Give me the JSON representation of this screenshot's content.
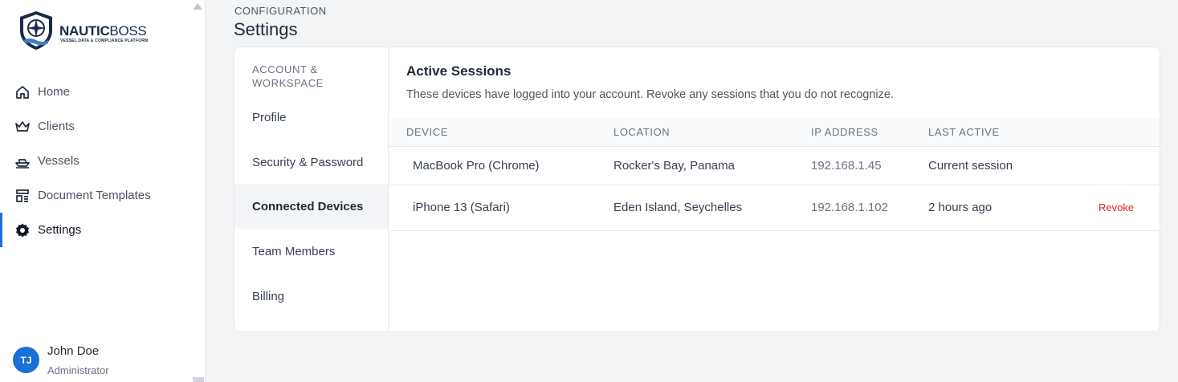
{
  "brand": {
    "name_bold": "NAUTIC",
    "name_rest": "BOSS",
    "tagline": "VESSEL DATA & COMPLIANCE PLATFORM",
    "primary_color": "#1a2b47",
    "accent_color": "#1d6fd8"
  },
  "sidebar": {
    "items": [
      {
        "label": "Home",
        "icon": "home-icon"
      },
      {
        "label": "Clients",
        "icon": "crown-icon"
      },
      {
        "label": "Vessels",
        "icon": "ship-icon"
      },
      {
        "label": "Document Templates",
        "icon": "template-icon"
      },
      {
        "label": "Settings",
        "icon": "gear-icon",
        "active": true
      }
    ]
  },
  "user": {
    "initials": "TJ",
    "name": "John Doe",
    "role": "Administrator"
  },
  "header": {
    "eyebrow": "CONFIGURATION",
    "title": "Settings"
  },
  "settings_nav": {
    "group_label": "ACCOUNT & WORKSPACE",
    "items": [
      {
        "label": "Profile"
      },
      {
        "label": "Security & Password"
      },
      {
        "label": "Connected Devices",
        "active": true
      },
      {
        "label": "Team Members"
      },
      {
        "label": "Billing"
      }
    ]
  },
  "sessions": {
    "title": "Active Sessions",
    "description": "These devices have logged into your account. Revoke any sessions that you do not recognize.",
    "columns": [
      "DEVICE",
      "LOCATION",
      "IP ADDRESS",
      "LAST ACTIVE"
    ],
    "rows": [
      {
        "device": "MacBook Pro (Chrome)",
        "location": "Rocker's Bay, Panama",
        "ip": "192.168.1.45",
        "last_active": "Current session",
        "action": ""
      },
      {
        "device": "iPhone 13 (Safari)",
        "location": "Eden Island, Seychelles",
        "ip": "192.168.1.102",
        "last_active": "2 hours ago",
        "action": "Revoke"
      }
    ],
    "danger_color": "#dc2626"
  }
}
